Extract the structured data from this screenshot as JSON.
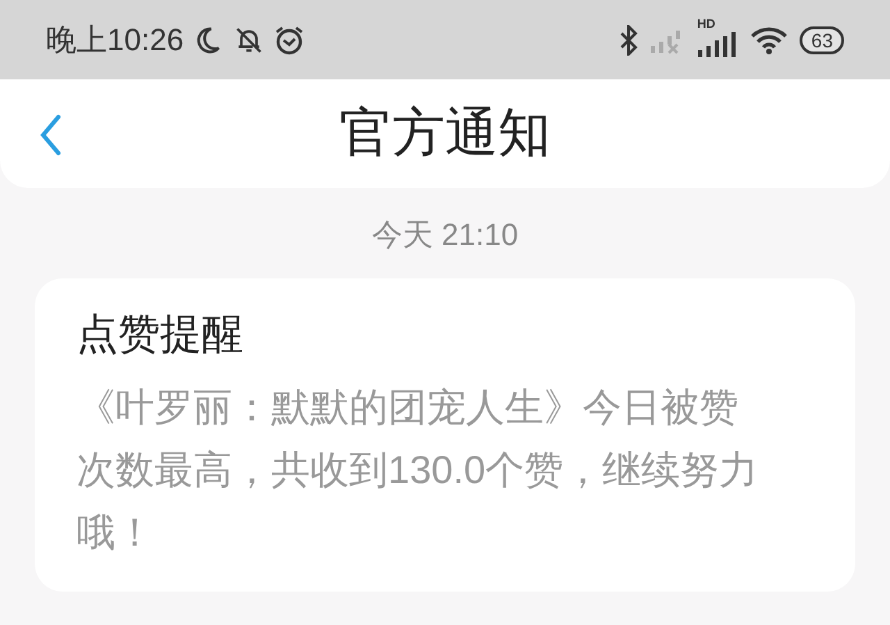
{
  "status_bar": {
    "time": "晚上10:26",
    "network_label": "HD",
    "battery": "63"
  },
  "header": {
    "title": "官方通知"
  },
  "messages": [
    {
      "timestamp": "今天 21:10",
      "title": "点赞提醒",
      "body": "《叶罗丽：默默的团宠人生》今日被赞次数最高，共收到130.0个赞，继续努力哦！"
    }
  ]
}
